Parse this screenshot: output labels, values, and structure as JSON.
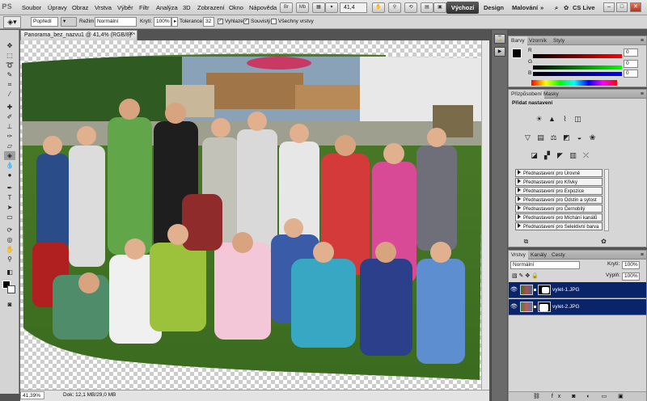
{
  "app": {
    "logo": "PS"
  },
  "menu": [
    "Soubor",
    "Úpravy",
    "Obraz",
    "Vrstva",
    "Výběr",
    "Filtr",
    "Analýza",
    "3D",
    "Zobrazení",
    "Okno",
    "Nápověda"
  ],
  "menubar_icons": {
    "br": "Br",
    "mb": "Mb"
  },
  "zoom_select": "41,4",
  "workspaces": {
    "active": "Výchozí",
    "design": "Design",
    "painting": "Malování",
    "expand": "»",
    "cslive": "CS Live"
  },
  "window_controls": {
    "minimize": "–",
    "restore": "□",
    "close": "✕"
  },
  "options_bar": {
    "mode_select": "Popředí",
    "mode_label": "Režim:",
    "mode_value": "Normální",
    "opacity_label": "Krytí:",
    "opacity_value": "100%",
    "tolerance_label": "Tolerance:",
    "tolerance_value": "32",
    "smoothing_label": "Vyhlazení",
    "contiguous_label": "Souvislý",
    "all_layers_label": "Všechny vrstvy"
  },
  "document": {
    "tab_title": "Panorama_bez_nazvu1 @ 41,4% (RGB/8) *",
    "zoom_status": "41,39%",
    "doc_status": "Dok: 12,1 MB/29,0 MB"
  },
  "color_panel": {
    "tabs": [
      "Barvy",
      "Vzorník",
      "Styly"
    ],
    "channels": [
      {
        "label": "R",
        "value": "0"
      },
      {
        "label": "G",
        "value": "0"
      },
      {
        "label": "B",
        "value": "0"
      }
    ]
  },
  "adjustments_panel": {
    "tabs": [
      "Přizpůsobení",
      "Masky"
    ],
    "title": "Přidat nastavení",
    "presets": [
      "Přednastavení pro Úrovně",
      "Přednastavení pro Křivky",
      "Přednastavení pro Expozice",
      "Přednastavení pro Odstín a sytost",
      "Přednastavení pro Černobílý",
      "Přednastavení pro Míchání kanálů",
      "Přednastavení pro Selektivní barva"
    ]
  },
  "layers_panel": {
    "tabs": [
      "Vrstvy",
      "Kanály",
      "Cesty"
    ],
    "blend_mode": "Normální",
    "opacity_label": "Krytí:",
    "opacity_value": "100%",
    "fill_label": "Výplň:",
    "fill_value": "100%",
    "layers": [
      {
        "name": "vylet-1.JPG",
        "selected": true
      },
      {
        "name": "vylet-2.JPG",
        "selected": true
      }
    ]
  },
  "colors": {
    "selection_blue": "#0a246a",
    "panel_gray": "#d6d6d6",
    "workspace_dark": "#535353"
  }
}
